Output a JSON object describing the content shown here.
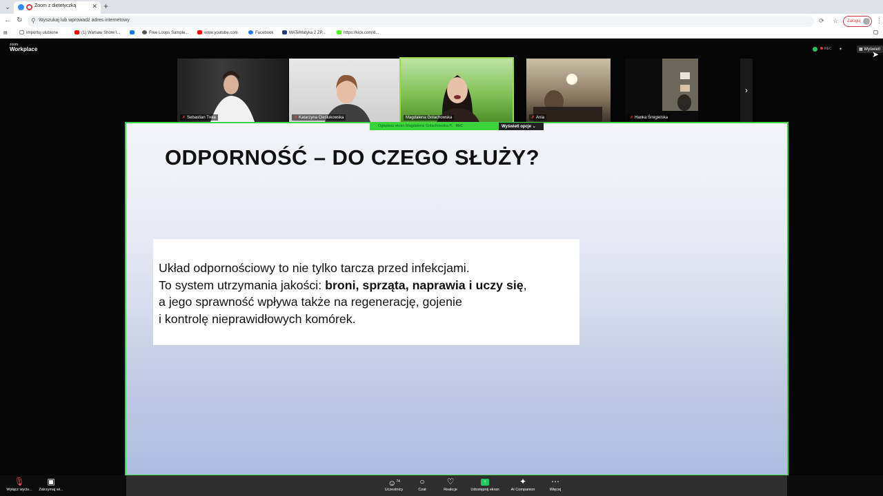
{
  "browser": {
    "tab_title": "Zoom z dietetyczką",
    "omnibox_placeholder": "Wyszukaj lub wprowadź adres internetowy",
    "login_label": "Zaloguj",
    "bookmarks": [
      {
        "label": "Importuj ulubione",
        "color": "#888888"
      },
      {
        "label": "(1) Warsaw Shore I...",
        "color": "#ff0000"
      },
      {
        "label": "Free Loops Sample...",
        "color": "#555555"
      },
      {
        "label": "www.youtube.com",
        "color": "#ff0000"
      },
      {
        "label": "Facebook",
        "color": "#1877f2"
      },
      {
        "label": "MATeMatyka 2 ZP...",
        "color": "#223a7a"
      },
      {
        "label": "https://kick.com/d...",
        "color": "#53fc18"
      }
    ]
  },
  "zoom": {
    "logo_small": "zoom",
    "logo_big": "Workplace",
    "rec_label": "REC",
    "view_label": "Wyświetl",
    "participants": [
      {
        "name": "Sebastian Trela",
        "muted": true
      },
      {
        "name": "Katarzyna Cieślukowska",
        "muted": true
      },
      {
        "name": "Magdalena Golachowska",
        "muted": false
      },
      {
        "name": "Ania",
        "muted": true
      },
      {
        "name": "Hanka Śmigielska",
        "muted": true
      }
    ],
    "share_bar": {
      "text": "Oglądasz ekran  Magdalena Golachowska",
      "rec": "REC",
      "view_options": "Wyświetl opcje"
    },
    "slide": {
      "title": "ODPORNOŚĆ – DO CZEGO SŁUŻY?",
      "line1": "Układ odpornościowy to nie tylko tarcza przed infekcjami.",
      "line2_prefix": "To system utrzymania jakości: ",
      "line2_bold": "broni, sprząta, naprawia i uczy się",
      "line2_suffix": ",",
      "line3": "a jego sprawność wpływa także na regenerację, gojenie",
      "line4": "i kontrolę nieprawidłowych komórek."
    },
    "toolbar": {
      "mute": "Wyłącz wycis...",
      "video": "Zatrzymaj wi...",
      "participants": "Uczestnicy",
      "participants_count": "74",
      "chat": "Czat",
      "reactions": "Reakcje",
      "share": "Udostępnij ekran",
      "ai": "AI Companion",
      "more": "Więcej"
    }
  }
}
